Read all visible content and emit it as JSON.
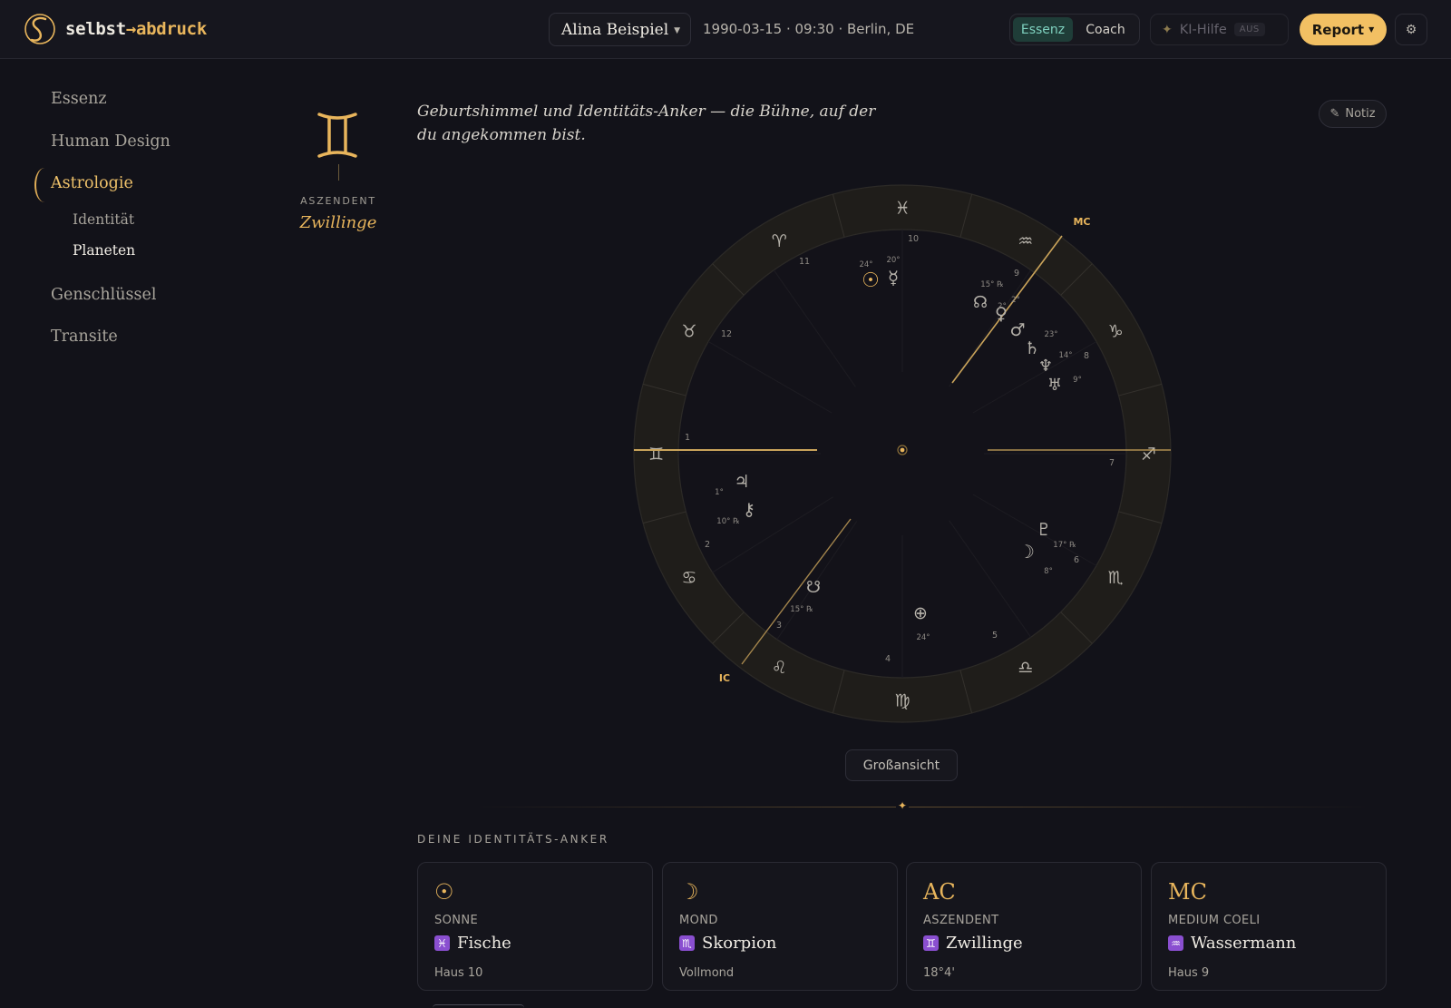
{
  "header": {
    "brand_prefix": "selbst",
    "brand_arrow": "→",
    "brand_suffix": "abdruck",
    "person": "Alina Beispiel",
    "birth_info": "1990-03-15 · 09:30 · Berlin, DE",
    "mode_active": "Essenz",
    "mode_other": "Coach",
    "ki_label": "KI-Hilfe",
    "ki_state": "AUS",
    "report_label": "Report",
    "settings_icon": "gear-icon"
  },
  "nav": {
    "items": [
      "Essenz",
      "Human Design",
      "Astrologie",
      "Genschlüssel",
      "Transite"
    ],
    "active": "Astrologie",
    "sub_items": [
      "Identität",
      "Planeten"
    ],
    "active_sub": "Planeten"
  },
  "ascendant": {
    "label": "ASZENDENT",
    "sign": "Zwillinge",
    "glyph": "gemini-icon"
  },
  "main": {
    "intro": "Geburtshimmel und Identitäts-Anker — die Bühne, auf der du angekommen bist.",
    "note_label": "Notiz",
    "zoom_label": "Großansicht",
    "section_title": "DEINE IDENTITÄTS-ANKER"
  },
  "chart": {
    "sign_ring": [
      {
        "sign": "pisces",
        "glyph": "♓"
      },
      {
        "sign": "aries",
        "glyph": "♈"
      },
      {
        "sign": "taurus",
        "glyph": "♉"
      },
      {
        "sign": "gemini",
        "glyph": "♊"
      },
      {
        "sign": "cancer",
        "glyph": "♋"
      },
      {
        "sign": "leo",
        "glyph": "♌"
      },
      {
        "sign": "virgo",
        "glyph": "♍"
      },
      {
        "sign": "libra",
        "glyph": "♎"
      },
      {
        "sign": "scorpio",
        "glyph": "♏"
      },
      {
        "sign": "sagittarius",
        "glyph": "♐"
      },
      {
        "sign": "capricorn",
        "glyph": "♑"
      },
      {
        "sign": "aquarius",
        "glyph": "♒"
      }
    ],
    "angles": {
      "mc": "MC",
      "ic": "IC"
    },
    "house_numbers": [
      "1",
      "2",
      "3",
      "4",
      "5",
      "6",
      "7",
      "8",
      "9",
      "10",
      "11",
      "12"
    ],
    "planets": [
      {
        "name": "sun",
        "glyph": "☉",
        "degree": "24°"
      },
      {
        "name": "mercury",
        "glyph": "☿",
        "degree": "20°"
      },
      {
        "name": "north-node",
        "glyph": "☊",
        "degree": "15° ℞"
      },
      {
        "name": "venus",
        "glyph": "♀",
        "degree": "2°"
      },
      {
        "name": "mars",
        "glyph": "♂",
        "degree": "2°"
      },
      {
        "name": "saturn",
        "glyph": "♄",
        "degree": "23°"
      },
      {
        "name": "neptune",
        "glyph": "♆",
        "degree": "14°"
      },
      {
        "name": "uranus",
        "glyph": "♅",
        "degree": "9°"
      },
      {
        "name": "jupiter",
        "glyph": "♃",
        "degree": "1°"
      },
      {
        "name": "chiron",
        "glyph": "⚷",
        "degree": "10° ℞"
      },
      {
        "name": "south-node",
        "glyph": "☋",
        "degree": "15° ℞"
      },
      {
        "name": "part-of-fortune",
        "glyph": "⊕",
        "degree": "24°"
      },
      {
        "name": "pluto",
        "glyph": "♇",
        "degree": "17° ℞"
      },
      {
        "name": "moon",
        "glyph": "☽",
        "degree": "8°"
      }
    ]
  },
  "anchors": [
    {
      "glyph": "☉",
      "kind": "SONNE",
      "sign_glyph": "♓",
      "sign": "Fische",
      "detail": "Haus 10"
    },
    {
      "glyph": "☽",
      "kind": "MOND",
      "sign_glyph": "♏",
      "sign": "Skorpion",
      "detail": "Vollmond"
    },
    {
      "glyph": "AC",
      "kind": "ASZENDENT",
      "sign_glyph": "♊",
      "sign": "Zwillinge",
      "detail": "18°4'"
    },
    {
      "glyph": "MC",
      "kind": "MEDIUM COELI",
      "sign_glyph": "♒",
      "sign": "Wassermann",
      "detail": "Haus 9"
    }
  ],
  "colors": {
    "accent": "#e8b55c",
    "background": "#121219",
    "mode_active": "#7fd1bf",
    "sign_chip": "#8a4fd0"
  }
}
